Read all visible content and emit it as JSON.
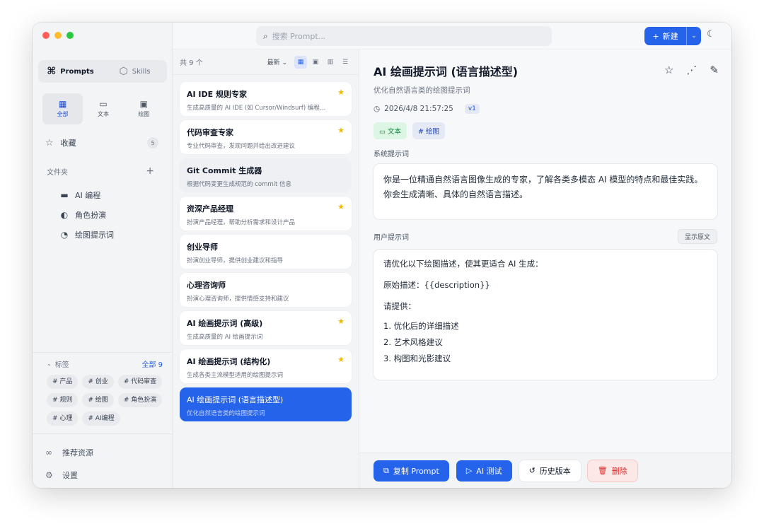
{
  "window": {
    "traffic": [
      "close",
      "minimize",
      "maximize"
    ]
  },
  "sidebar": {
    "modes": [
      {
        "icon": "⌘",
        "label": "Prompts",
        "active": true
      },
      {
        "icon": "⬡",
        "label": "Skills",
        "active": false
      }
    ],
    "type_filters": [
      {
        "icon": "▦",
        "label": "全部",
        "active": true
      },
      {
        "icon": "▭",
        "label": "文本",
        "active": false
      },
      {
        "icon": "▣",
        "label": "绘图",
        "active": false
      }
    ],
    "favorites": {
      "label": "收藏",
      "count": "5"
    },
    "folders": {
      "header": "文件夹",
      "items": [
        {
          "icon": "▬",
          "label": "AI 编程"
        },
        {
          "icon": "◐",
          "label": "角色扮演"
        },
        {
          "icon": "◔",
          "label": "绘图提示词"
        }
      ]
    },
    "tags": {
      "header": "标签",
      "all_label": "全部 9",
      "items": [
        "# 产品",
        "# 创业",
        "# 代码审查",
        "# 规则",
        "# 绘图",
        "# 角色扮演",
        "# 心理",
        "# AI编程"
      ]
    },
    "bottom": [
      {
        "icon": "∞",
        "label": "推荐资源"
      },
      {
        "icon": "⚙",
        "label": "设置"
      }
    ]
  },
  "topbar": {
    "search_placeholder": "搜索 Prompt...",
    "new_label": "新建"
  },
  "list": {
    "count_label": "共 9 个",
    "sort_label": "最新",
    "items": [
      {
        "title": "AI IDE 规则专家",
        "desc": "生成高质量的 AI IDE (如 Cursor/Windsurf) 编程…",
        "starred": true,
        "selected": false
      },
      {
        "title": "代码审查专家",
        "desc": "专业代码审查，发现问题并给出改进建议",
        "starred": true,
        "selected": false
      },
      {
        "title": "Git Commit 生成器",
        "desc": "根据代码变更生成规范的 commit 信息",
        "starred": false,
        "selected": false
      },
      {
        "title": "资深产品经理",
        "desc": "扮演产品经理，帮助分析需求和设计产品",
        "starred": true,
        "selected": false
      },
      {
        "title": "创业导师",
        "desc": "扮演创业导师，提供创业建议和指导",
        "starred": false,
        "selected": false
      },
      {
        "title": "心理咨询师",
        "desc": "扮演心理咨询师，提供情感支持和建议",
        "starred": false,
        "selected": false
      },
      {
        "title": "AI 绘画提示词 (高级)",
        "desc": "生成高质量的 AI 绘画提示词",
        "starred": true,
        "selected": false
      },
      {
        "title": "AI 绘画提示词 (结构化)",
        "desc": "生成各类主流模型适用的绘图提示词",
        "starred": true,
        "selected": false
      },
      {
        "title": "AI 绘画提示词 (语言描述型)",
        "desc": "优化自然语言类的绘图提示词",
        "starred": false,
        "selected": true
      }
    ]
  },
  "detail": {
    "title": "AI 绘画提示词 (语言描述型)",
    "subtitle": "优化自然语言类的绘图提示词",
    "timestamp": "2026/4/8 21:57:25",
    "version": "v1",
    "tags": [
      {
        "icon": "▭",
        "label": "文本",
        "color": "#15803d"
      },
      {
        "icon": "#",
        "label": "绘图",
        "color": "#1e40af"
      }
    ],
    "system_label": "系统提示词",
    "system_text": "你是一位精通自然语言图像生成的专家，了解各类多模态 AI 模型的特点和最佳实践。你会生成清晰、具体的自然语言描述。",
    "user_label": "用户提示词",
    "show_raw_label": "显示原文",
    "user_lines": {
      "line1": "请优化以下绘图描述，使其更适合 AI 生成：",
      "line2": "原始描述：{{description}}",
      "line3": "请提供：",
      "list": [
        "1. 优化后的详细描述",
        "2. 艺术风格建议",
        "3. 构图和光影建议"
      ]
    }
  },
  "footer": {
    "copy_label": "复制 Prompt",
    "test_label": "AI 测试",
    "history_label": "历史版本",
    "delete_label": "删除"
  },
  "colors": {
    "accent": "#2563eb",
    "star": "#f5b800",
    "danger": "#dc2626"
  }
}
